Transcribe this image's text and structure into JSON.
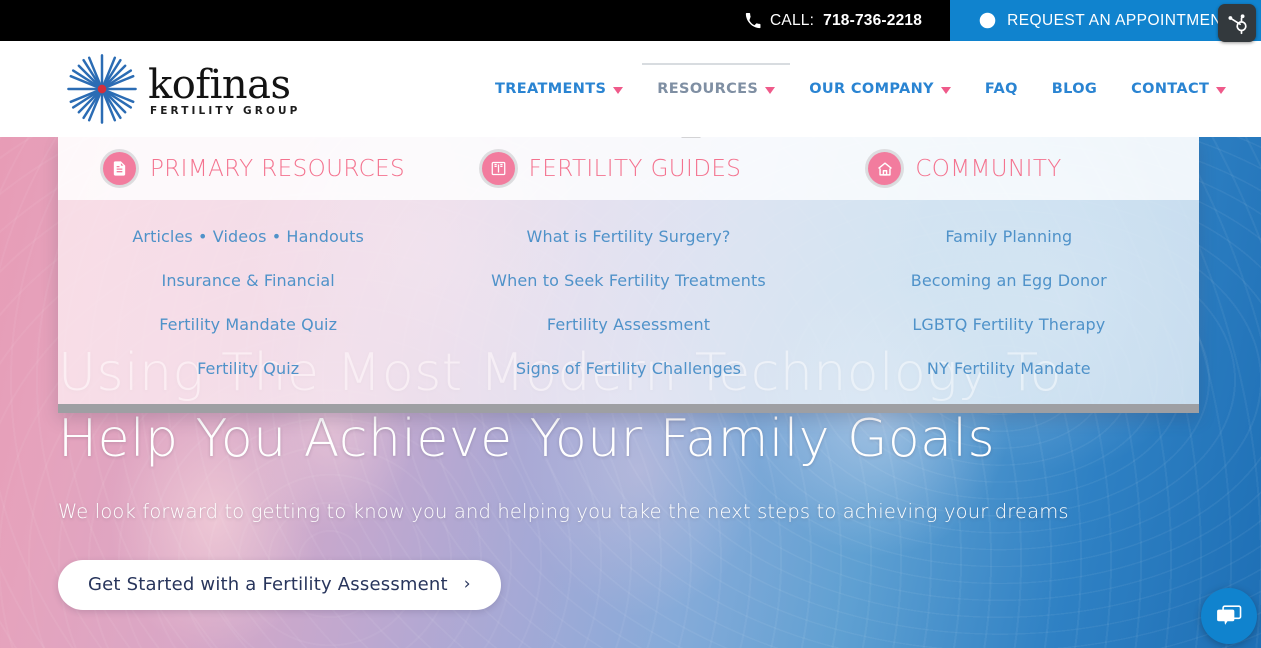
{
  "topbar": {
    "phone_icon": "phone-icon",
    "call_label": "CALL:",
    "call_number": "718-736-2218",
    "clock_icon": "clock-icon",
    "appointment_label": "REQUEST AN APPOINTMENT",
    "appointment_bg": "#1083ce",
    "hubspot_icon": "hubspot-sprocket-icon"
  },
  "logo": {
    "mark": "starburst-icon",
    "name": "kofinas",
    "tagline": "FERTILITY GROUP",
    "mark_color": "#2b6cb4",
    "mark_center_color": "#d32f3c"
  },
  "nav": {
    "items": [
      {
        "label": "TREATMENTS",
        "has_caret": true,
        "active": false
      },
      {
        "label": "RESOURCES",
        "has_caret": true,
        "active": true
      },
      {
        "label": "OUR COMPANY",
        "has_caret": true,
        "active": false
      },
      {
        "label": "FAQ",
        "has_caret": false,
        "active": false
      },
      {
        "label": "BLOG",
        "has_caret": false,
        "active": false
      },
      {
        "label": "CONTACT",
        "has_caret": true,
        "active": false
      }
    ],
    "link_color": "#2a84d2",
    "active_color": "#7f8fa3",
    "caret_color": "#ef5a8a"
  },
  "dropdown": {
    "open_for": "RESOURCES",
    "heading_color": "#f4738f",
    "link_color": "#4f92c9",
    "columns": [
      {
        "icon": "document-icon",
        "title": "PRIMARY RESOURCES",
        "links": [
          "Articles • Videos • Handouts",
          "Insurance & Financial",
          "Fertility Mandate Quiz",
          "Fertility Quiz"
        ]
      },
      {
        "icon": "book-icon",
        "title": "FERTILITY GUIDES",
        "links": [
          "What is Fertility Surgery?",
          "When to Seek Fertility Treatments",
          "Fertility Assessment",
          "Signs of Fertility Challenges"
        ]
      },
      {
        "icon": "home-icon",
        "title": "COMMUNITY",
        "links": [
          "Family Planning",
          "Becoming an Egg Donor",
          "LGBTQ Fertility Therapy",
          "NY Fertility Mandate"
        ]
      }
    ]
  },
  "hero": {
    "title_line1": "Using The Most Modern Technology To",
    "title_line2": "Help You Achieve Your Family Goals",
    "subtitle": "We look forward to getting to know you and helping you take the next steps to achieving your dreams",
    "cta_label": "Get Started with a Fertility Assessment",
    "cta_chevron": "›",
    "cta_text_color": "#28355c"
  },
  "chat": {
    "icon": "chat-bubble-icon",
    "color": "#1083ce"
  }
}
